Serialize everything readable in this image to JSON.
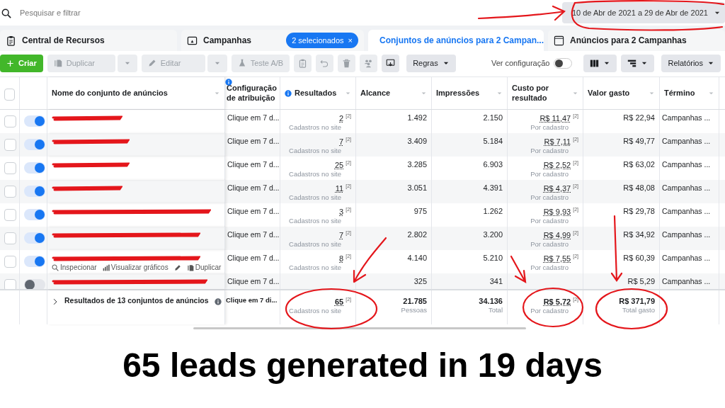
{
  "search": {
    "placeholder": "Pesquisar e filtrar"
  },
  "date_range": {
    "label": "10 de Abr de 2021 a 29 de Abr de 2021"
  },
  "tabs": [
    {
      "label": "Central de Recursos",
      "selected": false
    },
    {
      "label": "Campanhas",
      "selected": false,
      "badge": "2 selecionados",
      "badge_close": "×"
    },
    {
      "label": "Conjuntos de anúncios para 2 Campan...",
      "selected": true
    },
    {
      "label": "Anúncios para 2 Campanhas",
      "selected": false
    }
  ],
  "toolbar": {
    "create": "Criar",
    "actions": [
      {
        "kind": "split",
        "label": "Duplicar",
        "disabled": true
      },
      {
        "kind": "split",
        "label": "Editar",
        "disabled": true
      },
      {
        "kind": "plain",
        "label": "Teste A/B",
        "disabled": true
      },
      {
        "kind": "icon",
        "disabled": true
      },
      {
        "kind": "icon",
        "disabled": true
      },
      {
        "kind": "icon",
        "disabled": true
      },
      {
        "kind": "icon",
        "disabled": true
      },
      {
        "kind": "icon",
        "disabled": false
      },
      {
        "kind": "menu",
        "label": "Regras",
        "disabled": false
      }
    ],
    "view_settings": {
      "label": "Ver configuração",
      "on": false
    },
    "reports": "Relatórios"
  },
  "table": {
    "all_checked": false,
    "columns": [
      {
        "label": "Nome do conjunto de anúncios",
        "info": false
      },
      {
        "label": "Configuração de atribuição",
        "info": true
      },
      {
        "label": "Resultados",
        "info": true
      },
      {
        "label": "Alcance",
        "info": false
      },
      {
        "label": "Impressões",
        "info": false
      },
      {
        "label": "Custo por resultado",
        "info": false
      },
      {
        "label": "Valor gasto",
        "info": false
      },
      {
        "label": "Término",
        "info": false
      }
    ],
    "rows": [
      {
        "checked": false,
        "on": true,
        "attribution": "Clique em 7 d...",
        "result": "2",
        "result_ref": "[2]",
        "result_note": "Cadastros no site",
        "reach": "1.492",
        "impressions": "2.150",
        "cost": "R$ 11,47",
        "cost_ref": "[2]",
        "cost_note": "Por cadastro",
        "spent": "R$ 22,94",
        "end": "Campanhas ..."
      },
      {
        "checked": false,
        "on": true,
        "attribution": "Clique em 7 d...",
        "result": "7",
        "result_ref": "[2]",
        "result_note": "Cadastros no site",
        "reach": "3.409",
        "impressions": "5.184",
        "cost": "R$ 7,11",
        "cost_ref": "[2]",
        "cost_note": "Por cadastro",
        "spent": "R$ 49,77",
        "end": "Campanhas ..."
      },
      {
        "checked": false,
        "on": true,
        "attribution": "Clique em 7 d...",
        "result": "25",
        "result_ref": "[2]",
        "result_note": "Cadastros no site",
        "reach": "3.285",
        "impressions": "6.903",
        "cost": "R$ 2,52",
        "cost_ref": "[2]",
        "cost_note": "Por cadastro",
        "spent": "R$ 63,02",
        "end": "Campanhas ..."
      },
      {
        "checked": false,
        "on": true,
        "attribution": "Clique em 7 d...",
        "result": "11",
        "result_ref": "[2]",
        "result_note": "Cadastros no site",
        "reach": "3.051",
        "impressions": "4.391",
        "cost": "R$ 4,37",
        "cost_ref": "[2]",
        "cost_note": "Por cadastro",
        "spent": "R$ 48,08",
        "end": "Campanhas ..."
      },
      {
        "checked": false,
        "on": true,
        "attribution": "Clique em 7 d...",
        "result": "3",
        "result_ref": "[2]",
        "result_note": "Cadastros no site",
        "reach": "975",
        "impressions": "1.262",
        "cost": "R$ 9,93",
        "cost_ref": "[2]",
        "cost_note": "Por cadastro",
        "spent": "R$ 29,78",
        "end": "Campanhas ..."
      },
      {
        "checked": false,
        "on": true,
        "attribution": "Clique em 7 d...",
        "result": "7",
        "result_ref": "[2]",
        "result_note": "Cadastros no site",
        "reach": "2.802",
        "impressions": "3.200",
        "cost": "R$ 4,99",
        "cost_ref": "[2]",
        "cost_note": "Por cadastro",
        "spent": "R$ 34,92",
        "end": "Campanhas ..."
      },
      {
        "checked": false,
        "on": true,
        "attribution": "Clique em 7 d...",
        "result": "8",
        "result_ref": "[2]",
        "result_note": "Cadastros no site",
        "reach": "4.140",
        "impressions": "5.210",
        "cost": "R$ 7,55",
        "cost_ref": "[2]",
        "cost_note": "Por cadastro",
        "spent": "R$ 60,39",
        "end": "Campanhas ...",
        "hover_actions": [
          {
            "kind": "link",
            "label": "Inspecionar"
          },
          {
            "kind": "link",
            "label": "Visualizar gráficos"
          },
          {
            "kind": "icon"
          },
          {
            "kind": "link",
            "label": "Duplicar"
          }
        ]
      },
      {
        "checked": false,
        "on": false,
        "attribution": "Clique em 7 d...",
        "reach": "325",
        "impressions": "341",
        "spent": "R$ 5,29",
        "end": "Campanhas ..."
      }
    ],
    "footer": {
      "label": "Resultados de 13 conjuntos de anúncios",
      "attribution": "Clique em 7 di...",
      "result": "65",
      "result_ref": "[2]",
      "result_note": "Cadastros no site",
      "reach": "21.785",
      "reach_note": "Pessoas",
      "impressions": "34.136",
      "impressions_note": "Total",
      "cost": "R$ 5,72",
      "cost_ref": "[2]",
      "cost_note": "Por cadastro",
      "spent": "R$ 371,79",
      "spent_note": "Total gasto"
    }
  },
  "caption": "65 leads generated in 19 days"
}
